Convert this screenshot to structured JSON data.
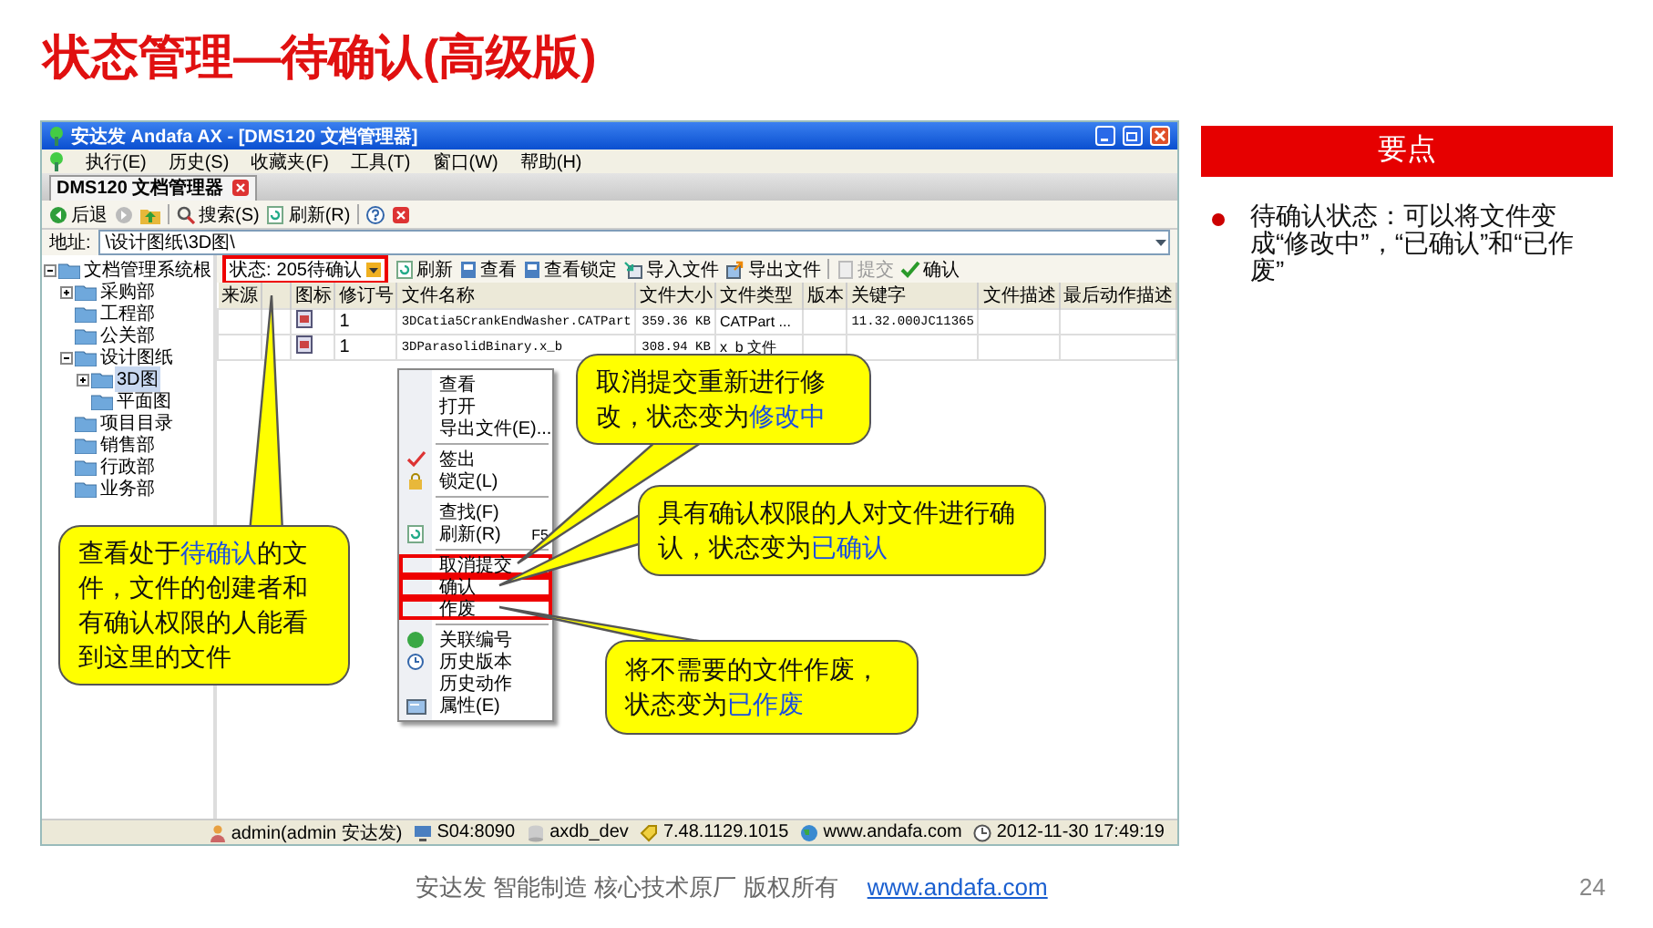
{
  "slide": {
    "title": "状态管理—待确认(高级版)",
    "page_number": "24"
  },
  "app_window": {
    "title": "安达发 Andafa AX - [DMS120 文档管理器]",
    "menu": [
      "执行(E)",
      "历史(S)",
      "收藏夹(F)",
      "工具(T)",
      "窗口(W)",
      "帮助(H)"
    ],
    "tabs": [
      {
        "label": "DMS120 文档管理器",
        "selected": true
      }
    ],
    "toolbar": [
      {
        "label": "后退"
      },
      {
        "label": "搜索(S)"
      },
      {
        "label": "刷新(R)"
      }
    ],
    "address": {
      "label": "地址:",
      "value": "\\设计图纸\\3D图\\"
    },
    "tree": [
      {
        "label": "文档管理系统根",
        "selected": false,
        "expanded": true,
        "children": [
          {
            "label": "采购部",
            "selected": false,
            "expanded": false
          },
          {
            "label": "工程部",
            "selected": false
          },
          {
            "label": "公关部",
            "selected": false
          },
          {
            "label": "设计图纸",
            "selected": false,
            "expanded": true,
            "children": [
              {
                "label": "3D图",
                "selected": true,
                "expanded": false
              },
              {
                "label": "平面图",
                "selected": false
              }
            ]
          },
          {
            "label": "项目目录",
            "selected": false
          },
          {
            "label": "销售部",
            "selected": false
          },
          {
            "label": "行政部",
            "selected": false
          },
          {
            "label": "业务部",
            "selected": false
          }
        ]
      }
    ],
    "filter": {
      "label": "状态:",
      "value": "205待确认",
      "highlighted": true
    },
    "actions": [
      {
        "label": "刷新",
        "disabled": false
      },
      {
        "label": "查看",
        "disabled": false
      },
      {
        "label": "查看锁定",
        "disabled": false
      },
      {
        "label": "导入文件",
        "disabled": false
      },
      {
        "label": "导出文件",
        "disabled": false
      },
      {
        "label": "提交",
        "disabled": true
      },
      {
        "label": "确认",
        "disabled": false
      }
    ],
    "table": {
      "columns": [
        "来源",
        "",
        "图标",
        "修订号",
        "文件名称",
        "文件大小",
        "文件类型",
        "版本",
        "关键字",
        "文件描述",
        "最后动作描述"
      ],
      "rows": [
        [
          "",
          "",
          "",
          "1",
          "3DCatia5CrankEndWasher.CATPart",
          "359.36 KB",
          "CATPart ...",
          "",
          "11.32.000JC11365",
          "",
          ""
        ],
        [
          "",
          "",
          "",
          "1",
          "3DParasolidBinary.x_b",
          "308.94 KB",
          "x_b 文件",
          "",
          "",
          "",
          ""
        ]
      ]
    },
    "context_menu": [
      {
        "kind": "item",
        "label": "查看",
        "highlighted": false
      },
      {
        "kind": "item",
        "label": "打开",
        "highlighted": false
      },
      {
        "kind": "item",
        "label": "导出文件(E)...",
        "highlighted": false
      },
      {
        "kind": "separator"
      },
      {
        "kind": "item",
        "label": "签出",
        "highlighted": false
      },
      {
        "kind": "item",
        "label": "锁定(L)",
        "highlighted": false
      },
      {
        "kind": "separator"
      },
      {
        "kind": "item",
        "label": "查找(F)",
        "highlighted": false
      },
      {
        "kind": "item",
        "label": "刷新(R)",
        "shortcut": "F5",
        "highlighted": false
      },
      {
        "kind": "separator"
      },
      {
        "kind": "item",
        "label": "取消提交",
        "highlighted": true
      },
      {
        "kind": "item",
        "label": "确认",
        "highlighted": true
      },
      {
        "kind": "item",
        "label": "作废",
        "highlighted": true
      },
      {
        "kind": "separator"
      },
      {
        "kind": "item",
        "label": "关联编号",
        "highlighted": false
      },
      {
        "kind": "item",
        "label": "历史版本",
        "highlighted": false
      },
      {
        "kind": "item",
        "label": "历史动作",
        "highlighted": false
      },
      {
        "kind": "item",
        "label": "属性(E)",
        "highlighted": false
      }
    ],
    "status_bar": [
      "admin(admin 安达发)",
      "S04:8090",
      "axdb_dev",
      "7.48.1129.1015",
      "www.andafa.com",
      "2012-11-30 17:49:19"
    ]
  },
  "callouts": [
    {
      "parts": [
        {
          "text": "查看处于",
          "emphasis": false
        },
        {
          "text": "待确认",
          "emphasis": true
        },
        {
          "text": "的文件，文件的创建者和有确认权限的人能看到这里的文件",
          "emphasis": false
        }
      ]
    },
    {
      "parts": [
        {
          "text": "取消提交重新进行修改，状态变为",
          "emphasis": false
        },
        {
          "text": "修改中",
          "emphasis": true
        }
      ]
    },
    {
      "parts": [
        {
          "text": "具有确认权限的人对文件进行确认，状态变为",
          "emphasis": false
        },
        {
          "text": "已确认",
          "emphasis": true
        }
      ]
    },
    {
      "parts": [
        {
          "text": "将不需要的文件作废，状态变为",
          "emphasis": false
        },
        {
          "text": "已作废",
          "emphasis": true
        }
      ]
    }
  ],
  "key_points": {
    "heading": "要点",
    "items": [
      "待确认状态：可以将文件变成“修改中”，“已确认”和“已作废”"
    ]
  },
  "footer": {
    "text": "安达发  智能制造 核心技术原厂   版权所有",
    "link": "www.andafa.com"
  }
}
